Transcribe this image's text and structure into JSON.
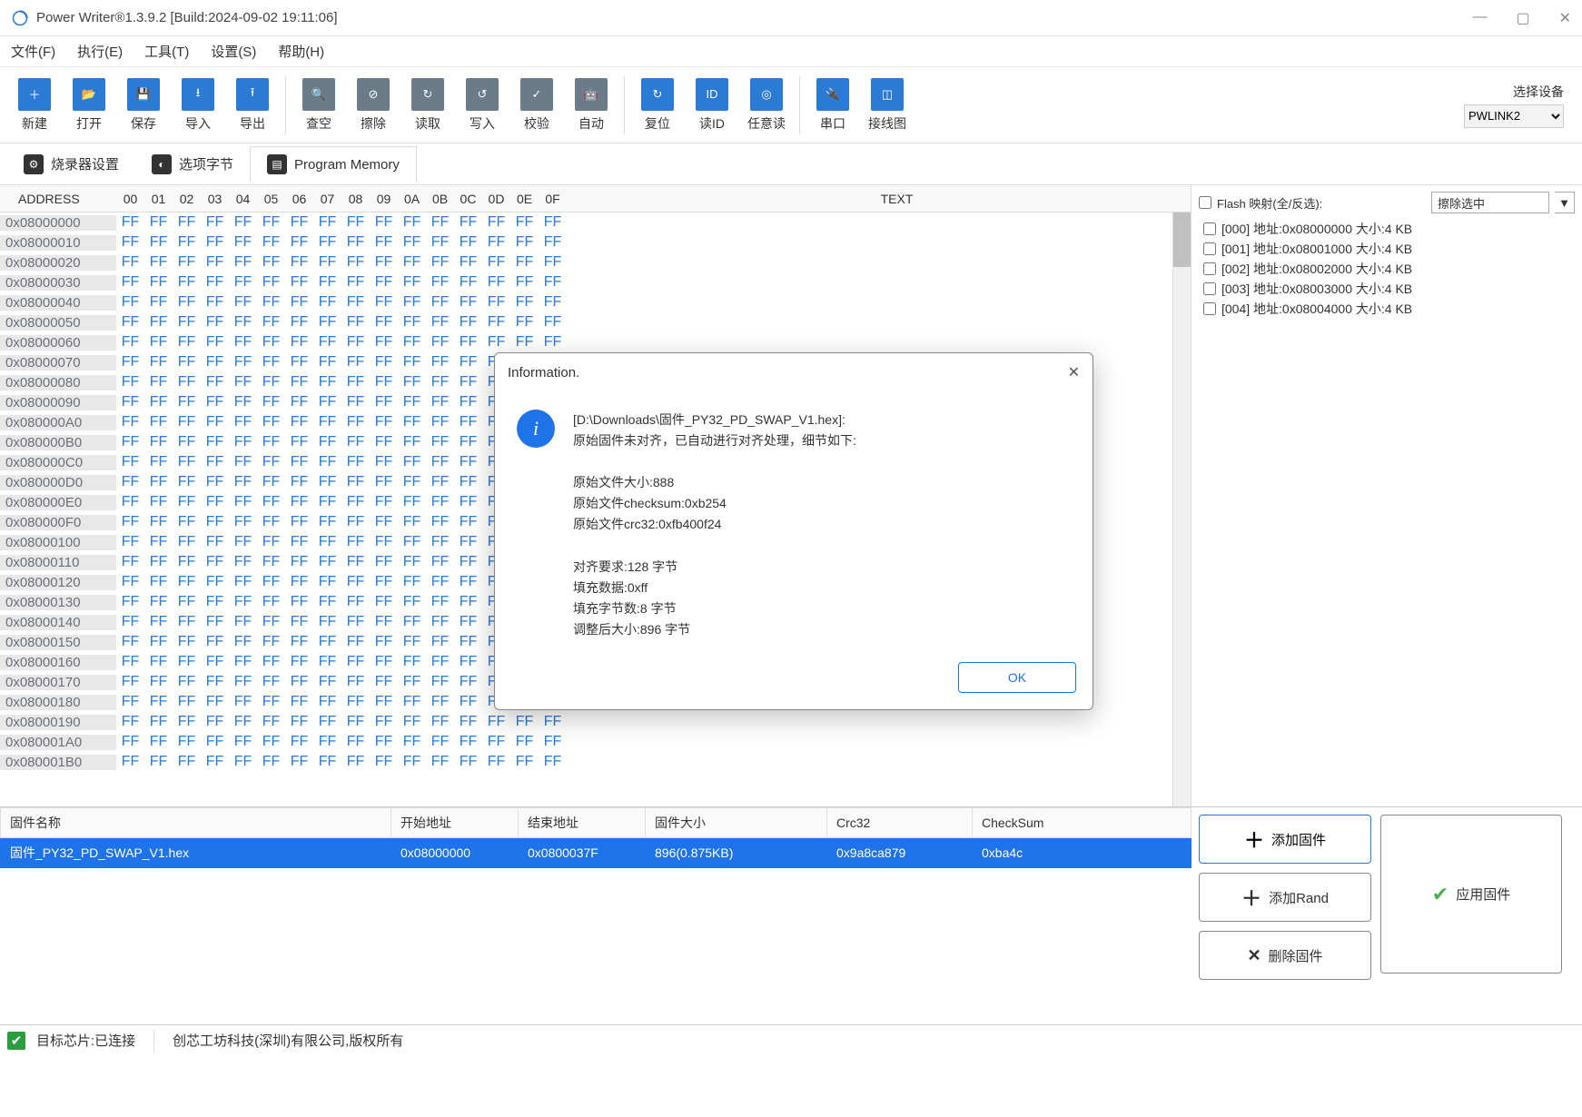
{
  "window": {
    "title": "Power Writer®1.3.9.2 [Build:2024-09-02 19:11:06]"
  },
  "menu": {
    "file": "文件(F)",
    "run": "执行(E)",
    "tool": "工具(T)",
    "setting": "设置(S)",
    "help": "帮助(H)"
  },
  "toolbar": {
    "new": "新建",
    "open": "打开",
    "save": "保存",
    "import": "导入",
    "export": "导出",
    "blank": "查空",
    "erase": "擦除",
    "read": "读取",
    "write": "写入",
    "verify": "校验",
    "auto": "自动",
    "reset": "复位",
    "readid": "读ID",
    "anyread": "任意读",
    "serial": "串口",
    "wiring": "接线图",
    "device_label": "选择设备",
    "device_value": "PWLINK2"
  },
  "tabs": {
    "burner": "烧录器设置",
    "option": "选项字节",
    "memory": "Program Memory"
  },
  "hex": {
    "addr_header": "ADDRESS",
    "text_header": "TEXT",
    "cols": [
      "00",
      "01",
      "02",
      "03",
      "04",
      "05",
      "06",
      "07",
      "08",
      "09",
      "0A",
      "0B",
      "0C",
      "0D",
      "0E",
      "0F"
    ],
    "addrs": [
      "0x08000000",
      "0x08000010",
      "0x08000020",
      "0x08000030",
      "0x08000040",
      "0x08000050",
      "0x08000060",
      "0x08000070",
      "0x08000080",
      "0x08000090",
      "0x080000A0",
      "0x080000B0",
      "0x080000C0",
      "0x080000D0",
      "0x080000E0",
      "0x080000F0",
      "0x08000100",
      "0x08000110",
      "0x08000120",
      "0x08000130",
      "0x08000140",
      "0x08000150",
      "0x08000160",
      "0x08000170",
      "0x08000180",
      "0x08000190",
      "0x080001A0",
      "0x080001B0"
    ],
    "byte": "FF"
  },
  "flash": {
    "header": "Flash 映射(全/反选):",
    "dropdown": "擦除选中",
    "items": [
      "[000] 地址:0x08000000 大小:4 KB",
      "[001] 地址:0x08001000 大小:4 KB",
      "[002] 地址:0x08002000 大小:4 KB",
      "[003] 地址:0x08003000 大小:4 KB",
      "[004] 地址:0x08004000 大小:4 KB"
    ]
  },
  "fwtable": {
    "col_name": "固件名称",
    "col_start": "开始地址",
    "col_end": "结束地址",
    "col_size": "固件大小",
    "col_crc": "Crc32",
    "col_chk": "CheckSum",
    "row": {
      "name": "固件_PY32_PD_SWAP_V1.hex",
      "start": "0x08000000",
      "end": "0x0800037F",
      "size": "896(0.875KB)",
      "crc": "0x9a8ca879",
      "chk": "0xba4c"
    }
  },
  "fwbtns": {
    "add_fw": "添加固件",
    "add_rand": "添加Rand",
    "del_fw": "删除固件",
    "apply": "应用固件"
  },
  "status": {
    "chip": "目标芯片:已连接",
    "company": "创芯工坊科技(深圳)有限公司,版权所有"
  },
  "modal": {
    "title": "Information.",
    "line1": "[D:\\Downloads\\固件_PY32_PD_SWAP_V1.hex]:",
    "line2": "原始固件未对齐，已自动进行对齐处理，细节如下:",
    "line3": "原始文件大小:888",
    "line4": "原始文件checksum:0xb254",
    "line5": "原始文件crc32:0xfb400f24",
    "line6": "对齐要求:128 字节",
    "line7": "填充数据:0xff",
    "line8": "填充字节数:8 字节",
    "line9": "调整后大小:896 字节",
    "ok": "OK"
  }
}
